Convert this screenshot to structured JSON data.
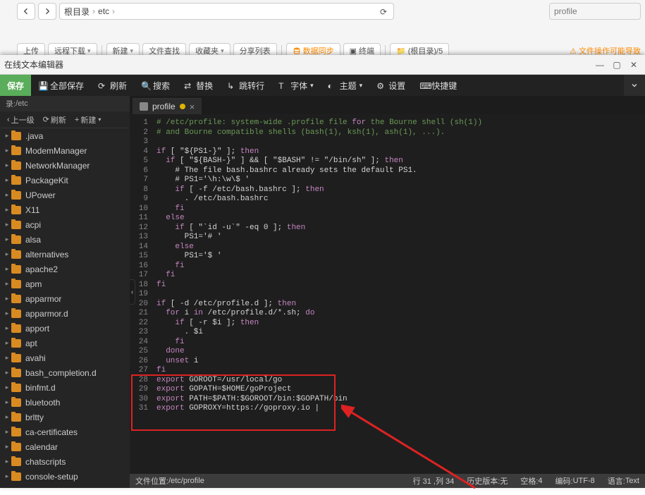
{
  "topbar": {
    "breadcrumbs": [
      "根目录",
      "etc"
    ],
    "search_value": "profile",
    "toolbar": [
      {
        "label": "上传",
        "caret": false
      },
      {
        "label": "远程下载",
        "caret": true
      },
      {
        "label": "新建",
        "caret": true
      },
      {
        "label": "文件查找",
        "caret": false
      },
      {
        "label": "收藏夹",
        "caret": true
      },
      {
        "label": "分享列表",
        "caret": false
      }
    ],
    "db_label": "数据同步",
    "terminal_label": "终端",
    "root_list_label": "(根目录)/5",
    "warn_label": "文件操作可能导致"
  },
  "editor": {
    "title": "在线文本编辑器",
    "menu": {
      "save": "保存",
      "save_all": "全部保存",
      "refresh": "刷新",
      "search": "搜索",
      "replace": "替换",
      "jump": "跳转行",
      "font": "字体",
      "theme": "主题",
      "settings": "设置",
      "shortcuts": "快捷键"
    },
    "sidebar": {
      "path_prefix": "录: ",
      "path": "/etc",
      "tools": {
        "up": "上一级",
        "refresh": "刷新",
        "new": "新建"
      },
      "items": [
        ".java",
        "ModemManager",
        "NetworkManager",
        "PackageKit",
        "UPower",
        "X11",
        "acpi",
        "alsa",
        "alternatives",
        "apache2",
        "apm",
        "apparmor",
        "apparmor.d",
        "apport",
        "apt",
        "avahi",
        "bash_completion.d",
        "binfmt.d",
        "bluetooth",
        "brltty",
        "ca-certificates",
        "calendar",
        "chatscripts",
        "console-setup"
      ]
    },
    "tab": {
      "name": "profile"
    },
    "code": [
      "# /etc/profile: system-wide .profile file for the Bourne shell (sh(1))",
      "# and Bourne compatible shells (bash(1), ksh(1), ash(1), ...).",
      "",
      "if [ \"${PS1-}\" ]; then",
      "  if [ \"${BASH-}\" ] && [ \"$BASH\" != \"/bin/sh\" ]; then",
      "    # The file bash.bashrc already sets the default PS1.",
      "    # PS1='\\h:\\w\\$ '",
      "    if [ -f /etc/bash.bashrc ]; then",
      "      . /etc/bash.bashrc",
      "    fi",
      "  else",
      "    if [ \"`id -u`\" -eq 0 ]; then",
      "      PS1='# '",
      "    else",
      "      PS1='$ '",
      "    fi",
      "  fi",
      "fi",
      "",
      "if [ -d /etc/profile.d ]; then",
      "  for i in /etc/profile.d/*.sh; do",
      "    if [ -r $i ]; then",
      "      . $i",
      "    fi",
      "  done",
      "  unset i",
      "fi",
      "export GOROOT=/usr/local/go",
      "export GOPATH=$HOME/goProject",
      "export PATH=$PATH:$GOROOT/bin:$GOPATH/bin",
      "export GOPROXY=https://goproxy.io |"
    ],
    "status": {
      "file_loc_label": "文件位置: ",
      "file_loc": "/etc/profile",
      "cursor_label": "行 31 ,列 34",
      "history_label": "历史版本: ",
      "history_val": "无",
      "indent_label": "空格: ",
      "indent_val": "4",
      "encoding_label": "编码: ",
      "encoding_val": "UTF-8",
      "lang_label": "语言: ",
      "lang_val": "Text"
    }
  }
}
